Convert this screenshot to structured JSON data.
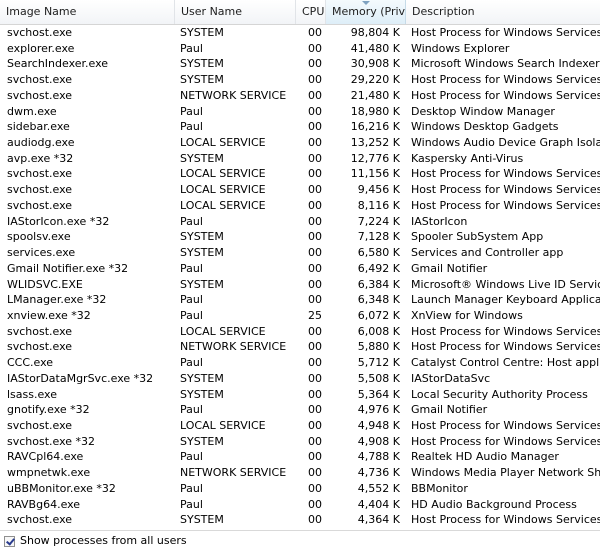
{
  "columns": {
    "image_name": "Image Name",
    "user_name": "User Name",
    "cpu": "CPU",
    "memory": "Memory (Priv...",
    "description": "Description"
  },
  "sorted_column": "memory",
  "processes": [
    {
      "image": "svchost.exe",
      "user": "SYSTEM",
      "cpu": "00",
      "mem": "98,804 K",
      "desc": "Host Process for Windows Services"
    },
    {
      "image": "explorer.exe",
      "user": "Paul",
      "cpu": "00",
      "mem": "41,480 K",
      "desc": "Windows Explorer"
    },
    {
      "image": "SearchIndexer.exe",
      "user": "SYSTEM",
      "cpu": "00",
      "mem": "30,908 K",
      "desc": "Microsoft Windows Search Indexer"
    },
    {
      "image": "svchost.exe",
      "user": "SYSTEM",
      "cpu": "00",
      "mem": "29,220 K",
      "desc": "Host Process for Windows Services"
    },
    {
      "image": "svchost.exe",
      "user": "NETWORK SERVICE",
      "cpu": "00",
      "mem": "21,480 K",
      "desc": "Host Process for Windows Services"
    },
    {
      "image": "dwm.exe",
      "user": "Paul",
      "cpu": "00",
      "mem": "18,980 K",
      "desc": "Desktop Window Manager"
    },
    {
      "image": "sidebar.exe",
      "user": "Paul",
      "cpu": "00",
      "mem": "16,216 K",
      "desc": "Windows Desktop Gadgets"
    },
    {
      "image": "audiodg.exe",
      "user": "LOCAL SERVICE",
      "cpu": "00",
      "mem": "13,252 K",
      "desc": "Windows Audio Device Graph Isolation"
    },
    {
      "image": "avp.exe *32",
      "user": "SYSTEM",
      "cpu": "00",
      "mem": "12,776 K",
      "desc": "Kaspersky Anti-Virus"
    },
    {
      "image": "svchost.exe",
      "user": "LOCAL SERVICE",
      "cpu": "00",
      "mem": "11,156 K",
      "desc": "Host Process for Windows Services"
    },
    {
      "image": "svchost.exe",
      "user": "LOCAL SERVICE",
      "cpu": "00",
      "mem": "9,456 K",
      "desc": "Host Process for Windows Services"
    },
    {
      "image": "svchost.exe",
      "user": "LOCAL SERVICE",
      "cpu": "00",
      "mem": "8,116 K",
      "desc": "Host Process for Windows Services"
    },
    {
      "image": "IAStorIcon.exe *32",
      "user": "Paul",
      "cpu": "00",
      "mem": "7,224 K",
      "desc": "IAStorIcon"
    },
    {
      "image": "spoolsv.exe",
      "user": "SYSTEM",
      "cpu": "00",
      "mem": "7,128 K",
      "desc": "Spooler SubSystem App"
    },
    {
      "image": "services.exe",
      "user": "SYSTEM",
      "cpu": "00",
      "mem": "6,580 K",
      "desc": "Services and Controller app"
    },
    {
      "image": "Gmail Notifier.exe *32",
      "user": "Paul",
      "cpu": "00",
      "mem": "6,492 K",
      "desc": "Gmail Notifier"
    },
    {
      "image": "WLIDSVC.EXE",
      "user": "SYSTEM",
      "cpu": "00",
      "mem": "6,384 K",
      "desc": "Microsoft® Windows Live ID Service"
    },
    {
      "image": "LManager.exe *32",
      "user": "Paul",
      "cpu": "00",
      "mem": "6,348 K",
      "desc": "Launch Manager Keyboard Application"
    },
    {
      "image": "xnview.exe *32",
      "user": "Paul",
      "cpu": "25",
      "mem": "6,072 K",
      "desc": "XnView for Windows"
    },
    {
      "image": "svchost.exe",
      "user": "LOCAL SERVICE",
      "cpu": "00",
      "mem": "6,008 K",
      "desc": "Host Process for Windows Services"
    },
    {
      "image": "svchost.exe",
      "user": "NETWORK SERVICE",
      "cpu": "00",
      "mem": "5,880 K",
      "desc": "Host Process for Windows Services"
    },
    {
      "image": "CCC.exe",
      "user": "Paul",
      "cpu": "00",
      "mem": "5,712 K",
      "desc": "Catalyst Control Centre: Host application"
    },
    {
      "image": "IAStorDataMgrSvc.exe *32",
      "user": "SYSTEM",
      "cpu": "00",
      "mem": "5,508 K",
      "desc": "IAStorDataSvc"
    },
    {
      "image": "lsass.exe",
      "user": "SYSTEM",
      "cpu": "00",
      "mem": "5,364 K",
      "desc": "Local Security Authority Process"
    },
    {
      "image": "gnotify.exe *32",
      "user": "Paul",
      "cpu": "00",
      "mem": "4,976 K",
      "desc": "Gmail Notifier"
    },
    {
      "image": "svchost.exe",
      "user": "LOCAL SERVICE",
      "cpu": "00",
      "mem": "4,948 K",
      "desc": "Host Process for Windows Services"
    },
    {
      "image": "svchost.exe *32",
      "user": "SYSTEM",
      "cpu": "00",
      "mem": "4,908 K",
      "desc": "Host Process for Windows Services"
    },
    {
      "image": "RAVCpl64.exe",
      "user": "Paul",
      "cpu": "00",
      "mem": "4,788 K",
      "desc": "Realtek HD Audio Manager"
    },
    {
      "image": "wmpnetwk.exe",
      "user": "NETWORK SERVICE",
      "cpu": "00",
      "mem": "4,736 K",
      "desc": "Windows Media Player Network Sharing Se"
    },
    {
      "image": "uBBMonitor.exe *32",
      "user": "Paul",
      "cpu": "00",
      "mem": "4,552 K",
      "desc": "BBMonitor"
    },
    {
      "image": "RAVBg64.exe",
      "user": "Paul",
      "cpu": "00",
      "mem": "4,404 K",
      "desc": "HD Audio Background Process"
    },
    {
      "image": "svchost.exe",
      "user": "SYSTEM",
      "cpu": "00",
      "mem": "4,364 K",
      "desc": "Host Process for Windows Services"
    }
  ],
  "footer": {
    "show_all_users_label": "Show processes from all users",
    "show_all_users_checked": true
  }
}
